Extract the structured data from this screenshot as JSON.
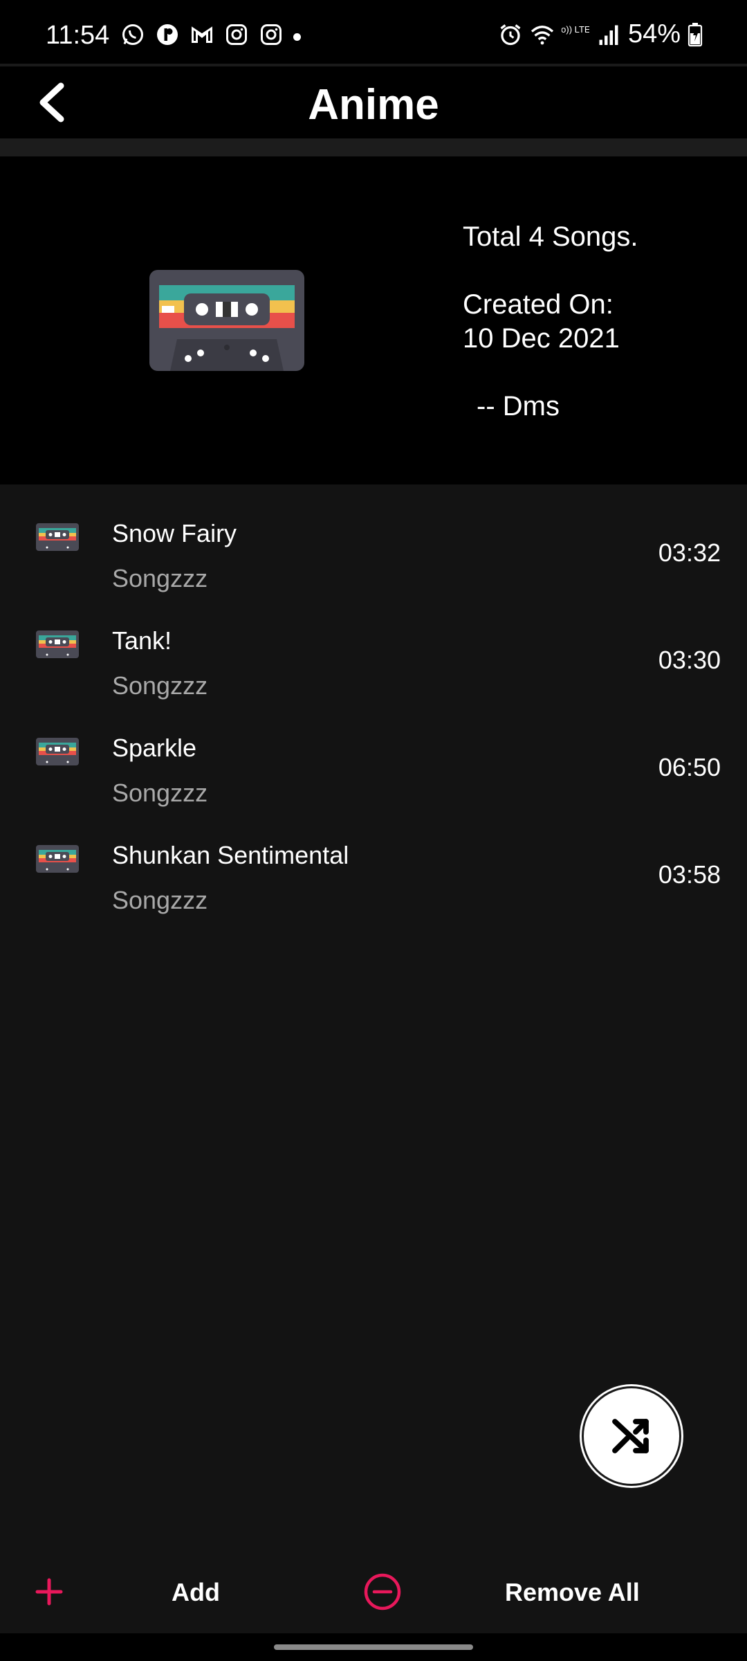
{
  "status_bar": {
    "time": "11:54",
    "left_icons": [
      "whatsapp-icon",
      "app-icon",
      "gmail-icon",
      "instagram-icon",
      "instagram-icon"
    ],
    "right_icons": [
      "alarm-icon",
      "wifi-icon",
      "volte-icon",
      "signal-icon",
      "battery-charging-icon"
    ],
    "volte_text": "Vo)) LTE1",
    "battery_percent": "54%"
  },
  "header": {
    "title": "Anime",
    "back_icon": "back-arrow-icon"
  },
  "playlist_info": {
    "total_songs": "Total 4 Songs.",
    "created_label": "Created On:",
    "created_date": "10 Dec 2021",
    "author": "-- Dms",
    "cover_icon": "cassette-icon"
  },
  "songs": [
    {
      "title": "Snow Fairy",
      "artist": "Songzzz",
      "duration": "03:32"
    },
    {
      "title": "Tank!",
      "artist": "Songzzz",
      "duration": "03:30"
    },
    {
      "title": "Sparkle",
      "artist": "Songzzz",
      "duration": "06:50"
    },
    {
      "title": "Shunkan Sentimental",
      "artist": "Songzzz",
      "duration": "03:58"
    }
  ],
  "fab": {
    "icon": "shuffle-icon"
  },
  "bottom_bar": {
    "add_label": "Add",
    "remove_all_label": "Remove All",
    "add_icon": "plus-icon",
    "remove_icon": "minus-circle-icon"
  },
  "colors": {
    "accent": "#e8185b",
    "background": "#131313",
    "panel": "#000000",
    "secondary_text": "#a9a9a9"
  }
}
